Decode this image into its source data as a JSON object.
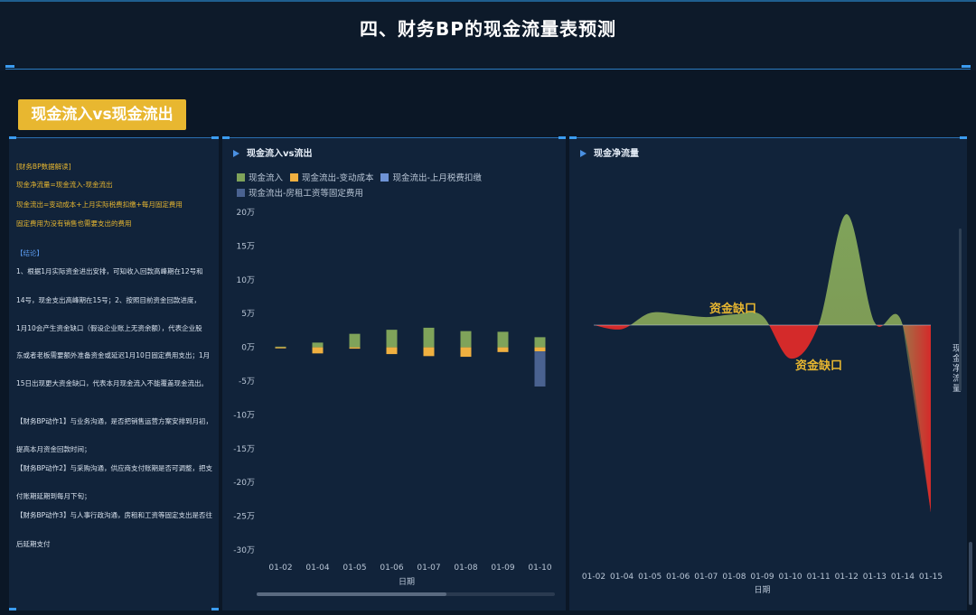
{
  "page": {
    "title": "四、财务BP的现金流量表预测",
    "section_label": "现金流入vs现金流出"
  },
  "left_panel": {
    "lines": [
      {
        "text": "[财务BP数据解读]",
        "style": "yellow"
      },
      {
        "text": "现金净流量=现金流入-现金流出",
        "style": "yellow"
      },
      {
        "text": "现金流出=变动成本+上月实际税费扣缴+每月固定费用",
        "style": "yellow"
      },
      {
        "text": "固定费用为没有销售也需要支出的费用",
        "style": "yellow"
      },
      {
        "text": "【结论】",
        "style": "blue"
      },
      {
        "text": "1、根据1月实际资金进出安排，可知收入回款高峰期在12号和",
        "style": "white"
      },
      {
        "text": "14号，现金支出高峰期在15号；2、按照目前资金回款进度，",
        "style": "white"
      },
      {
        "text": "1月10会产生资金缺口（假设企业账上无资余额），代表企业股",
        "style": "white"
      },
      {
        "text": "东或者老板需要额外准备资金或延迟1月10日固定费用支出；1月",
        "style": "white"
      },
      {
        "text": "15日出现更大资金缺口，代表本月现金流入不能覆盖现金流出。",
        "style": "white"
      },
      {
        "text": "【财务BP动作1】与业务沟通，是否把销售运营方案安排到月初，",
        "style": "white"
      },
      {
        "text": "提高本月资金回款时间；",
        "style": "white"
      },
      {
        "text": "【财务BP动作2】与采购沟通，供应商支付账期是否可调整，把支",
        "style": "white"
      },
      {
        "text": "付账期延期到每月下旬；",
        "style": "white"
      },
      {
        "text": "【财务BP动作3】与人事行政沟通，房租和工资等固定支出是否往",
        "style": "white"
      },
      {
        "text": "后延期支付",
        "style": "white"
      }
    ]
  },
  "bar_chart_panel": {
    "title": "现金流入vs流出",
    "x_axis_name": "日期",
    "y_unit_suffix": "万"
  },
  "area_chart_panel": {
    "title": "现金净流量",
    "x_axis_name": "日期",
    "y_axis_name": "现金净流量",
    "annotations": [
      "资金缺口",
      "资金缺口"
    ]
  },
  "colors": {
    "inflow": "#7fa35a",
    "variable_cost": "#f0b040",
    "tax": "#6e93d6",
    "fixed": "#4a6290",
    "gap_red": "#d42a2a",
    "accent_yellow": "#e8b730"
  },
  "chart_data": [
    {
      "type": "bar",
      "title": "现金流入vs流出",
      "xlabel": "日期",
      "ylabel": "",
      "categories": [
        "01-02",
        "01-04",
        "01-05",
        "01-06",
        "01-07",
        "01-08",
        "01-09",
        "01-10"
      ],
      "ylim": [
        -300000,
        200000
      ],
      "yticks": [
        200000,
        150000,
        100000,
        50000,
        0,
        -50000,
        -100000,
        -150000,
        -200000,
        -250000,
        -300000
      ],
      "ytick_labels": [
        "20万",
        "15万",
        "10万",
        "5万",
        "0万",
        "-5万",
        "-10万",
        "-15万",
        "-20万",
        "-25万",
        "-30万"
      ],
      "legend_position": "top-left",
      "series": [
        {
          "name": "现金流入",
          "values": [
            1000,
            7000,
            20000,
            26000,
            29000,
            24000,
            23000,
            15000
          ]
        },
        {
          "name": "现金流出-变动成本",
          "values": [
            -1500,
            -9000,
            -2000,
            -10000,
            -13000,
            -14000,
            -7000,
            -6000
          ]
        },
        {
          "name": "现金流出-上月税费扣缴",
          "values": [
            0,
            0,
            0,
            0,
            0,
            0,
            0,
            0
          ]
        },
        {
          "name": "现金流出-房租工资等固定费用",
          "values": [
            0,
            0,
            0,
            0,
            0,
            0,
            0,
            -52000
          ]
        }
      ]
    },
    {
      "type": "area",
      "title": "现金净流量",
      "xlabel": "日期",
      "ylabel": "现金净流量",
      "categories": [
        "01-02",
        "01-04",
        "01-05",
        "01-06",
        "01-07",
        "01-08",
        "01-09",
        "01-10",
        "01-11",
        "01-12",
        "01-13",
        "01-14",
        "01-15"
      ],
      "series": [
        {
          "name": "现金净流量",
          "values": [
            0,
            -3000,
            9000,
            8000,
            6000,
            8000,
            7000,
            -25000,
            0,
            83000,
            2000,
            0,
            -140000
          ]
        }
      ],
      "annotations": [
        {
          "text": "资金缺口",
          "near": "01-09"
        },
        {
          "text": "资金缺口",
          "near": "01-10"
        }
      ]
    }
  ]
}
